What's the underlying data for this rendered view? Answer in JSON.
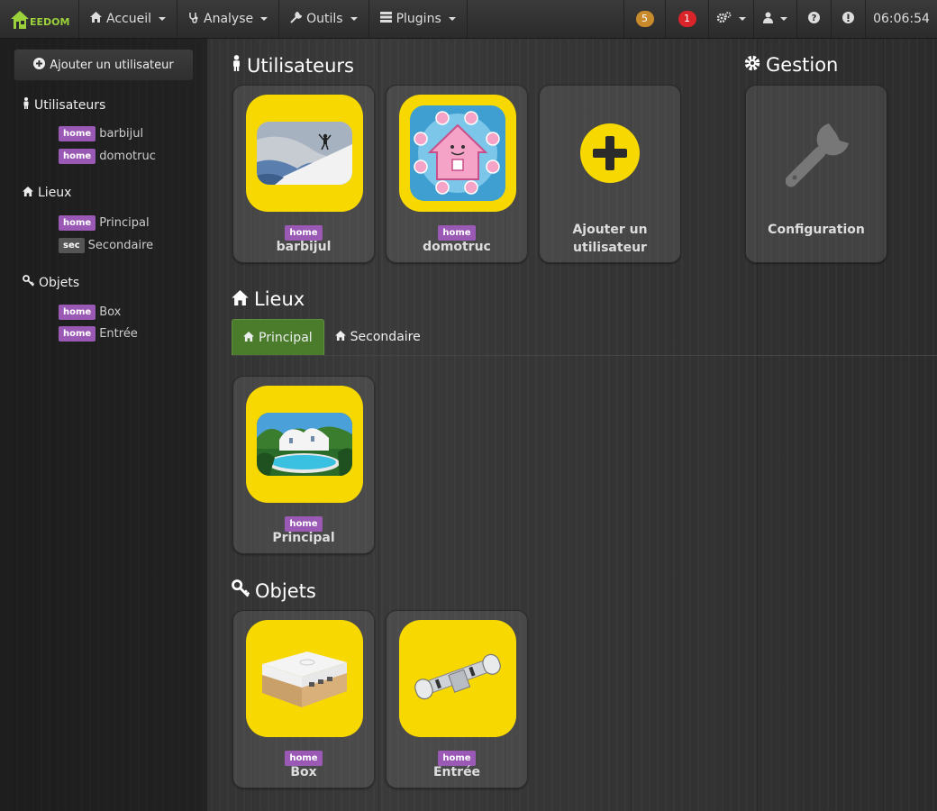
{
  "navbar": {
    "brand_text": "EEDOM",
    "menus": [
      {
        "label": "Accueil",
        "icon": "home-icon"
      },
      {
        "label": "Analyse",
        "icon": "stethoscope-icon"
      },
      {
        "label": "Outils",
        "icon": "wrench-icon"
      },
      {
        "label": "Plugins",
        "icon": "tasks-icon"
      }
    ],
    "badge_message_count": "5",
    "badge_alert_count": "1",
    "clock": "06:06:54"
  },
  "sidebar": {
    "add_user_label": "Ajouter un utilisateur",
    "sections": {
      "users": {
        "title": "Utilisateurs",
        "items": [
          {
            "tag": "home",
            "label": "barbijul"
          },
          {
            "tag": "home",
            "label": "domotruc"
          }
        ]
      },
      "places": {
        "title": "Lieux",
        "items": [
          {
            "tag": "home",
            "label": "Principal"
          },
          {
            "tag": "sec",
            "label": "Secondaire"
          }
        ]
      },
      "objects": {
        "title": "Objets",
        "items": [
          {
            "tag": "home",
            "label": "Box"
          },
          {
            "tag": "home",
            "label": "Entrée"
          }
        ]
      }
    }
  },
  "main": {
    "users_title": "Utilisateurs",
    "users": [
      {
        "tag": "home",
        "label": "barbijul"
      },
      {
        "tag": "home",
        "label": "domotruc"
      }
    ],
    "add_user_card_label_1": "Ajouter un",
    "add_user_card_label_2": "utilisateur",
    "gestion_title": "Gestion",
    "config_label": "Configuration",
    "places_title": "Lieux",
    "tabs": [
      {
        "label": "Principal",
        "active": true
      },
      {
        "label": "Secondaire",
        "active": false
      }
    ],
    "places": [
      {
        "tag": "home",
        "label": "Principal"
      }
    ],
    "objects_title": "Objets",
    "objects": [
      {
        "tag": "home",
        "label": "Box"
      },
      {
        "tag": "home",
        "label": "Entrée"
      }
    ]
  },
  "colors": {
    "accent_yellow": "#f7d800",
    "tag_home": "#9b59b6",
    "tab_active": "#4a7c2c",
    "badge_orange": "#c98a2c",
    "badge_red": "#d9242a"
  }
}
